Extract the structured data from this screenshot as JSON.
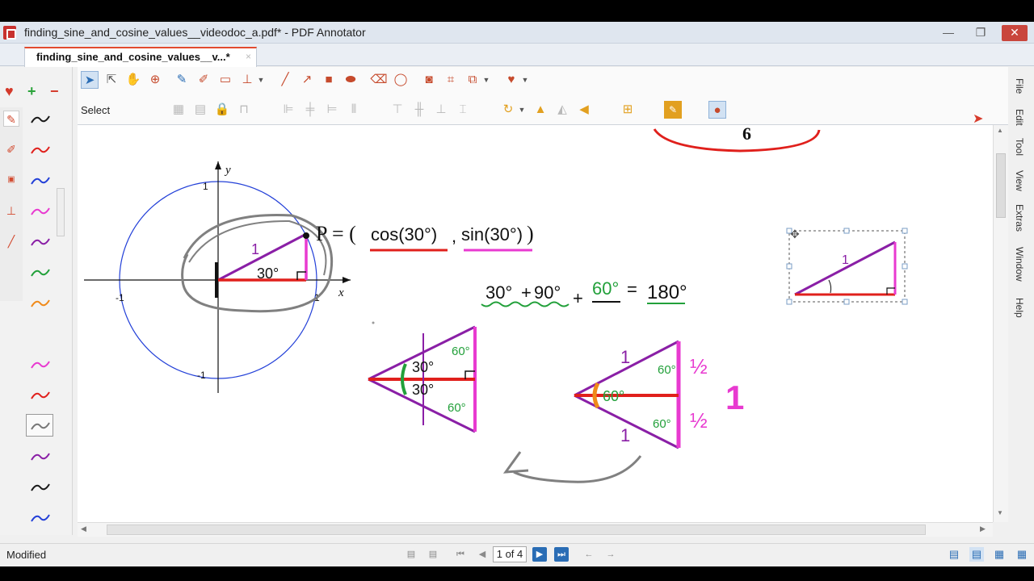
{
  "window": {
    "title": "finding_sine_and_cosine_values__videodoc_a.pdf* - PDF Annotator",
    "minimize": "—",
    "restore": "❐",
    "close": "✕"
  },
  "tab": {
    "label": "finding_sine_and_cosine_values__v...*",
    "close": "×"
  },
  "toolbar": {
    "select_label": "Select"
  },
  "side_menu": [
    "File",
    "Edit",
    "Tool",
    "View",
    "Extras",
    "Window",
    "Help"
  ],
  "pens": {
    "colors": [
      "#1a1a1a",
      "#e0201c",
      "#2340d8",
      "#e83ad0",
      "#8a1fa6",
      "#22a03a",
      "#f08a1a",
      "#e83ad0",
      "#e0201c",
      "#777777",
      "#8a1fa6",
      "#1a1a1a",
      "#2340d8"
    ]
  },
  "document": {
    "axis_y": "y",
    "axis_x": "x",
    "tick_top": "1",
    "tick_bottom": "-1",
    "tick_left": "-1",
    "tick_right": "1",
    "hyp_label": "1",
    "angle_label": "30°",
    "point_eq": "P = (",
    "cos_text": "cos(30°)",
    "comma": ",",
    "sin_text": "sin(30°)",
    "close_paren": ")",
    "sum_30": "30°",
    "plus1": "+",
    "sum_90": "90°",
    "plus2": "+",
    "sum_60": "60°",
    "equals": "=",
    "sum_180": "180°",
    "top_number": "6",
    "tri1_top60": "60°",
    "tri1_30a": "30°",
    "tri1_30b": "30°",
    "tri1_bot60": "60°",
    "tri2_one_top": "1",
    "tri2_60top": "60°",
    "tri2_60mid": "60°",
    "tri2_60bot": "60°",
    "tri2_one_bot": "1",
    "half_top": "½",
    "half_bot": "½",
    "big_one": "1",
    "small_tri_one": "1"
  },
  "status": {
    "text": "Modified",
    "page": "1 of 4"
  }
}
